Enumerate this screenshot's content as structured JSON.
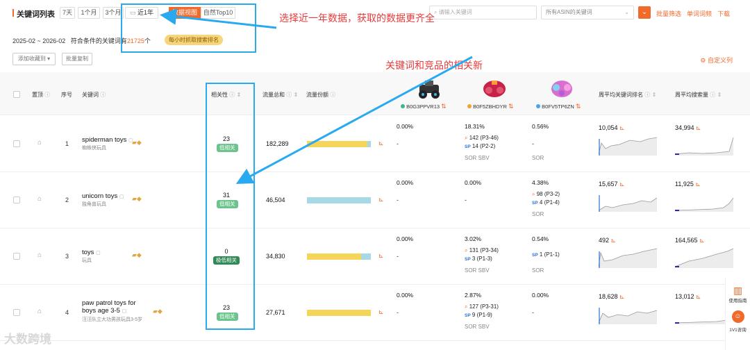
{
  "toolbar": {
    "title": "关键词列表",
    "ranges": [
      "7天",
      "1个月",
      "3个月"
    ],
    "range_selected": "近1年",
    "view_active": "数据视图",
    "view_other": "自然Top10",
    "search_placeholder": "请输入关键词",
    "asin_select": "所有ASIN的关键词",
    "batch_filter": "批量筛选",
    "word_freq": "单词词频",
    "download": "下载"
  },
  "summary": {
    "date_range": "2025-02 ~ 2026-02",
    "count_prefix": "符合条件的关键词有",
    "count": "21725",
    "count_suffix": "个",
    "hourly_badge": "每小时抓取搜索排名"
  },
  "actions": {
    "add_collection": "添加收藏到 ▾",
    "batch_copy": "批量复制",
    "custom_columns": "自定义列"
  },
  "annotations": {
    "top_note": "选择近一年数据，获取的数据更齐全",
    "mid_note": "关键词和竞品的相关新"
  },
  "columns": {
    "pin": "置顶",
    "index": "序号",
    "keyword": "关键词",
    "relevance": "相关性",
    "traffic_total": "流量总和",
    "traffic_share": "流量份额",
    "weekly_rank": "周平均关键词排名",
    "weekly_volume": "周平均搜索量"
  },
  "products": [
    {
      "asin": "B0G3PPVR13",
      "color": "#3bb58a"
    },
    {
      "asin": "B0F5ZBHDYR",
      "color": "#f0a330"
    },
    {
      "asin": "B0FV5TP6ZN",
      "color": "#4aa3e8"
    }
  ],
  "rows": [
    {
      "index": "1",
      "keyword": "spiderman toys",
      "sub": "蜘蛛侠玩具",
      "relevance": "23",
      "rel_label": "低相关",
      "traffic": "182,289",
      "share": [
        0.92,
        0.05
      ],
      "p1": {
        "pct": "0.00%",
        "l1": "-",
        "l2": "",
        "l3": ""
      },
      "p2": {
        "pct": "18.31%",
        "l1": "142 (P3-46)",
        "l2": "14 (P2-2)",
        "l3": "SOR SBV"
      },
      "p3": {
        "pct": "0.56%",
        "l1": "-",
        "l2": "",
        "l3": "SOR"
      },
      "rank": "10,054",
      "volume": "34,994"
    },
    {
      "index": "2",
      "keyword": "unicorn toys",
      "sub": "独角兽玩具",
      "relevance": "31",
      "rel_label": "低相关",
      "traffic": "46,504",
      "share": [
        0.0,
        0.97
      ],
      "p1": {
        "pct": "0.00%",
        "l1": "-",
        "l2": "",
        "l3": ""
      },
      "p2": {
        "pct": "0.00%",
        "l1": "-",
        "l2": "",
        "l3": ""
      },
      "p3": {
        "pct": "4.38%",
        "l1": "98 (P3-2)",
        "l2": "4 (P1-4)",
        "l3": "SOR"
      },
      "rank": "15,657",
      "volume": "11,925"
    },
    {
      "index": "3",
      "keyword": "toys",
      "sub": "玩具",
      "relevance": "0",
      "rel_label": "极低相关",
      "traffic": "34,830",
      "share": [
        0.82,
        0.15
      ],
      "p1": {
        "pct": "0.00%",
        "l1": "-",
        "l2": "",
        "l3": ""
      },
      "p2": {
        "pct": "3.02%",
        "l1": "131 (P3-34)",
        "l2": "3 (P1-3)",
        "l3": "SOR SBV"
      },
      "p3": {
        "pct": "0.54%",
        "l1": "",
        "l2": "1 (P1-1)",
        "l3": "SOR"
      },
      "rank": "492",
      "volume": "164,565"
    },
    {
      "index": "4",
      "keyword": "paw patrol toys for boys age 3-5",
      "sub": "汪汪队立大功男孩玩具3-5岁",
      "relevance": "23",
      "rel_label": "低相关",
      "traffic": "27,671",
      "share": [
        0.97,
        0.0
      ],
      "p1": {
        "pct": "0.00%",
        "l1": "-",
        "l2": "",
        "l3": ""
      },
      "p2": {
        "pct": "2.87%",
        "l1": "127 (P3-31)",
        "l2": "9 (P1-9)",
        "l3": "SOR SBV"
      },
      "p3": {
        "pct": "0.00%",
        "l1": "-",
        "l2": "",
        "l3": ""
      },
      "rank": "18,628",
      "volume": "13,012"
    }
  ],
  "sidebar": {
    "guide": "使用指南",
    "consult": "1V1咨询"
  },
  "watermark": "大数跨境"
}
